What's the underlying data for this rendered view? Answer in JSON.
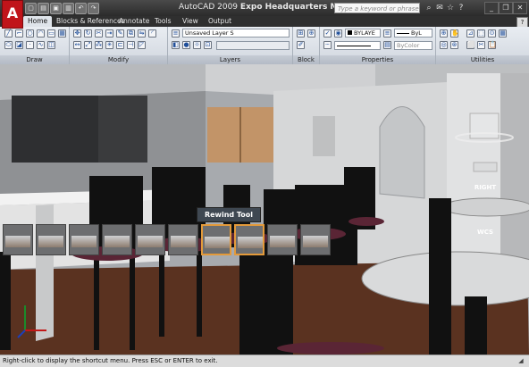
{
  "window": {
    "app_name": "AutoCAD 2009",
    "document": "Expo Headquarters Model.dwg",
    "logo_letter": "A"
  },
  "search": {
    "placeholder": "Type a keyword or phrase"
  },
  "tabs": [
    {
      "label": "Home",
      "active": true
    },
    {
      "label": "Blocks & References",
      "active": false
    },
    {
      "label": "Annotate",
      "active": false
    },
    {
      "label": "Tools",
      "active": false
    },
    {
      "label": "View",
      "active": false
    },
    {
      "label": "Output",
      "active": false
    }
  ],
  "ribbon": {
    "panels": [
      "Draw",
      "Modify",
      "Layers",
      "Block",
      "Properties",
      "Utilities"
    ],
    "layer_combo": "Unsaved Layer S",
    "color_combo": "BYLAYE",
    "linetype_combo": "ByL",
    "plotstyle_combo": "ByColor"
  },
  "viewport": {
    "rewind_tooltip": "Rewind Tool",
    "viewcube": {
      "face": "RIGHT",
      "compass": "WCS"
    }
  },
  "status": {
    "message": "Right-click to display the shortcut menu. Press ESC or ENTER to exit."
  },
  "colors": {
    "title_bar": "#2b2b2b",
    "ribbon": "#dfe4ea",
    "thumb_selected": "#e39a3a",
    "floor": "#5a3220",
    "wall": "#d8d8d8"
  },
  "icons": {
    "logo": "autocad-logo-icon",
    "help": "help-icon",
    "minimize": "minimize-icon",
    "restore": "restore-icon",
    "close": "close-icon"
  }
}
